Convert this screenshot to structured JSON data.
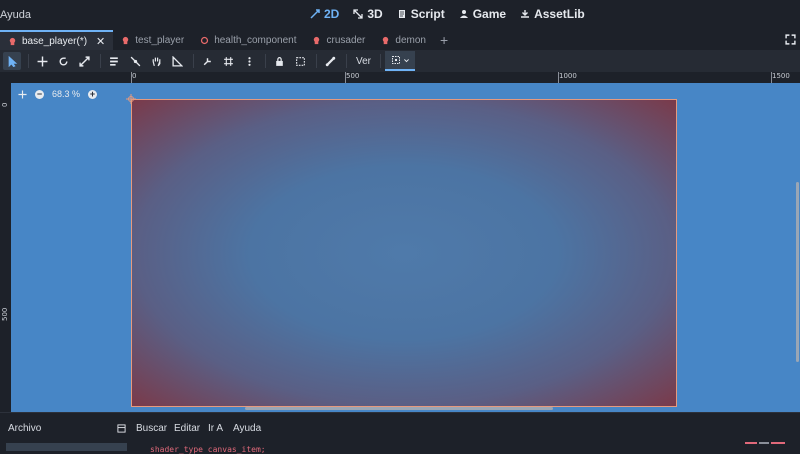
{
  "menu": {
    "help_label": "Ayuda"
  },
  "workspaces": [
    {
      "label": "2D",
      "icon": "2d-icon",
      "active": true
    },
    {
      "label": "3D",
      "icon": "3d-icon",
      "active": false
    },
    {
      "label": "Script",
      "icon": "script-icon",
      "active": false
    },
    {
      "label": "Game",
      "icon": "game-icon",
      "active": false
    },
    {
      "label": "AssetLib",
      "icon": "assetlib-icon",
      "active": false
    }
  ],
  "tabs": [
    {
      "label": "base_player(*)",
      "icon": "scene-icon",
      "active": true,
      "closable": true
    },
    {
      "label": "test_player",
      "icon": "scene-icon",
      "active": false
    },
    {
      "label": "health_component",
      "icon": "node-icon",
      "active": false
    },
    {
      "label": "crusader",
      "icon": "scene-icon",
      "active": false
    },
    {
      "label": "demon",
      "icon": "scene-icon",
      "active": false
    }
  ],
  "toolbar": {
    "view_label": "Ver"
  },
  "viewport": {
    "zoom_label": "68.3 %",
    "ruler_labels": [
      "0",
      "500",
      "1000",
      "1500"
    ],
    "left_ruler_labels": [
      "0",
      "500"
    ],
    "background_color": "#4786c6",
    "canvas_border_color": "#e69a7e"
  },
  "bottom": {
    "file_label": "Archivo",
    "menus": [
      "Buscar",
      "Editar",
      "Ir A",
      "Ayuda"
    ],
    "code_line": "shader_type canvas_item;"
  },
  "colors": {
    "accent": "#6fb2f5",
    "scene_icon": "#e86a6a"
  }
}
